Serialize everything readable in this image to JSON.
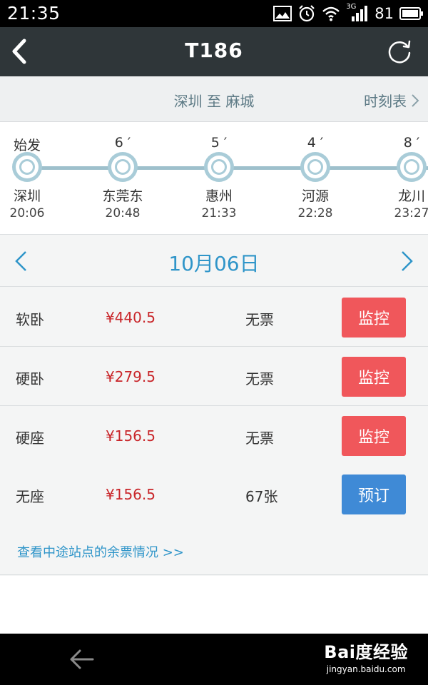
{
  "status_bar": {
    "time": "21:35",
    "network": "3G",
    "battery": "81",
    "icons": [
      "image-icon",
      "alarm-icon",
      "wifi-icon",
      "signal-icon",
      "battery-icon"
    ]
  },
  "header": {
    "title": "T186",
    "back_icon": "back-chevron-icon",
    "refresh_icon": "refresh-icon"
  },
  "route": {
    "text": "深圳 至 麻城",
    "schedule_label": "时刻表"
  },
  "stations": [
    {
      "duration": "始发",
      "name": "深圳",
      "time": "20:06"
    },
    {
      "duration": "6 ′",
      "name": "东莞东",
      "time": "20:48"
    },
    {
      "duration": "5 ′",
      "name": "惠州",
      "time": "21:33"
    },
    {
      "duration": "4 ′",
      "name": "河源",
      "time": "22:28"
    },
    {
      "duration": "8 ′",
      "name": "龙川",
      "time": "23:27"
    }
  ],
  "date": {
    "text": "10月06日"
  },
  "seats": [
    {
      "type": "软卧",
      "price": "¥440.5",
      "availability": "无票",
      "action": "监控",
      "action_kind": "monitor"
    },
    {
      "type": "硬卧",
      "price": "¥279.5",
      "availability": "无票",
      "action": "监控",
      "action_kind": "monitor"
    },
    {
      "type": "硬座",
      "price": "¥156.5",
      "availability": "无票",
      "action": "监控",
      "action_kind": "monitor"
    },
    {
      "type": "无座",
      "price": "¥156.5",
      "availability": "67张",
      "action": "预订",
      "action_kind": "book"
    }
  ],
  "midway_link": "查看中途站点的余票情况 >>",
  "watermark": {
    "logo": "Bai度经验",
    "sub": "jingyan.baidu.com"
  },
  "colors": {
    "monitor_button": "#f0575b",
    "book_button": "#3f8ad6",
    "price": "#c9262a",
    "accent": "#2f95c9",
    "title_bar": "#2f3639"
  }
}
